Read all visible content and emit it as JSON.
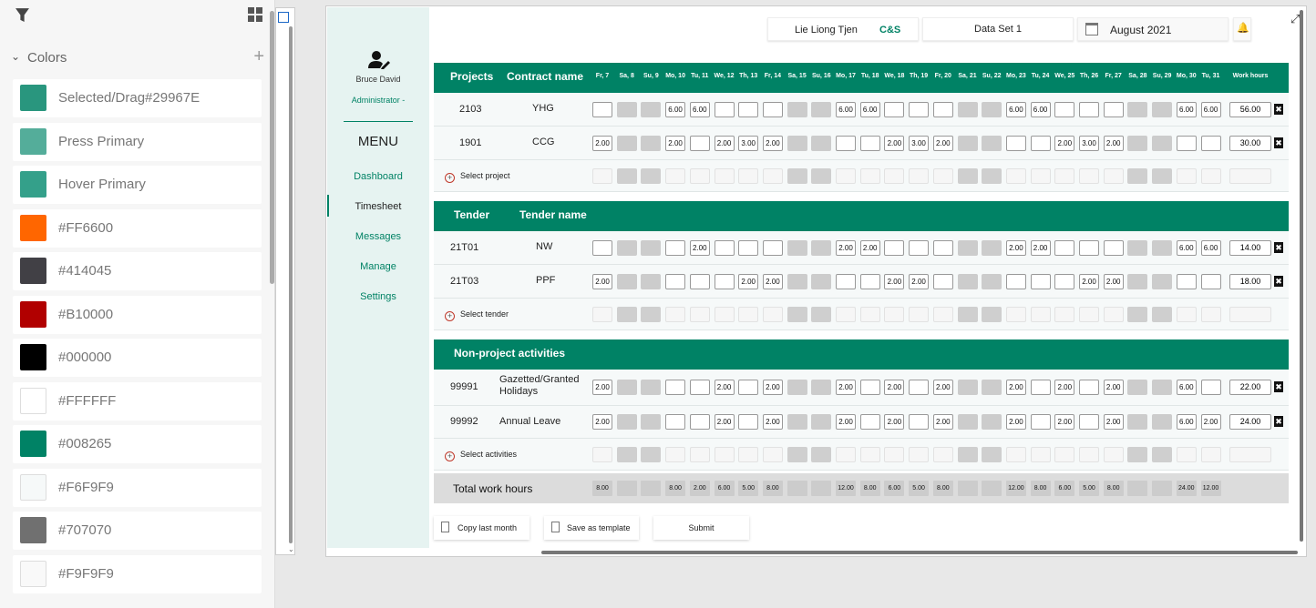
{
  "panel": {
    "section_title": "Colors",
    "swatches": [
      {
        "label": "Selected/Drag#29967E",
        "color": "#29967E"
      },
      {
        "label": "Press Primary",
        "color": "#54ad9a"
      },
      {
        "label": "Hover Primary",
        "color": "#34a08a"
      },
      {
        "label": "#FF6600",
        "color": "#FF6600"
      },
      {
        "label": "#414045",
        "color": "#414045"
      },
      {
        "label": "#B10000",
        "color": "#B10000"
      },
      {
        "label": "#000000",
        "color": "#000000"
      },
      {
        "label": "#FFFFFF",
        "color": "#FFFFFF"
      },
      {
        "label": "#008265",
        "color": "#008265"
      },
      {
        "label": "#F6F9F9",
        "color": "#F6F9F9"
      },
      {
        "label": "#707070",
        "color": "#707070"
      },
      {
        "label": "#F9F9F9",
        "color": "#F9F9F9"
      }
    ]
  },
  "app": {
    "user_name": "Bruce David",
    "user_role": "Administrator -",
    "menu_title": "MENU",
    "menu": [
      "Dashboard",
      "Timesheet",
      "Messages",
      "Manage",
      "Settings"
    ],
    "active_menu": "Timesheet",
    "topbar": {
      "user": "Lie Liong Tjen",
      "company": "C&S",
      "dataset": "Data Set 1",
      "month": "August 2021"
    },
    "days": [
      "Fr, 7",
      "Sa, 8",
      "Su, 9",
      "Mo, 10",
      "Tu, 11",
      "We, 12",
      "Th, 13",
      "Fr, 14",
      "Sa, 15",
      "Su, 16",
      "Mo, 17",
      "Tu, 18",
      "We, 18",
      "Th, 19",
      "Fr, 20",
      "Sa, 21",
      "Su, 22",
      "Mo, 23",
      "Tu, 24",
      "We, 25",
      "Th, 26",
      "Fr, 27",
      "Sa, 28",
      "Su, 29",
      "Mo, 30",
      "Tu, 31"
    ],
    "weekend_idx": [
      1,
      2,
      8,
      9,
      15,
      16,
      22,
      23
    ],
    "work_hours_label": "Work hours",
    "projects": {
      "col1": "Projects",
      "col2": "Contract name",
      "add_label": "Select project",
      "rows": [
        {
          "code": "2103",
          "name": "YHG",
          "total": "56.00",
          "hours": [
            "",
            "",
            "",
            "6.00",
            "6.00",
            "",
            "",
            "",
            "",
            "",
            "6.00",
            "6.00",
            "",
            "",
            "",
            "",
            "",
            "6.00",
            "6.00",
            "",
            "",
            "",
            "",
            "",
            "6.00",
            "6.00"
          ]
        },
        {
          "code": "1901",
          "name": "CCG",
          "total": "30.00",
          "hours": [
            "2.00",
            "",
            "",
            "2.00",
            "",
            "2.00",
            "3.00",
            "2.00",
            "",
            "",
            "",
            "",
            "2.00",
            "3.00",
            "2.00",
            "",
            "",
            "",
            "",
            "2.00",
            "3.00",
            "2.00",
            "",
            "",
            "",
            ""
          ]
        }
      ]
    },
    "tenders": {
      "col1": "Tender",
      "col2": "Tender name",
      "add_label": "Select tender",
      "rows": [
        {
          "code": "21T01",
          "name": "NW",
          "total": "14.00",
          "hours": [
            "",
            "",
            "",
            "",
            "2.00",
            "",
            "",
            "",
            "",
            "",
            "2.00",
            "2.00",
            "",
            "",
            "",
            "",
            "",
            "2.00",
            "2.00",
            "",
            "",
            "",
            "",
            "",
            "6.00",
            "6.00"
          ]
        },
        {
          "code": "21T03",
          "name": "PPF",
          "total": "18.00",
          "hours": [
            "2.00",
            "",
            "",
            "",
            "",
            "",
            "2.00",
            "2.00",
            "",
            "",
            "",
            "",
            "2.00",
            "2.00",
            "",
            "",
            "",
            "",
            "",
            "",
            "2.00",
            "2.00",
            "",
            "",
            "",
            ""
          ]
        }
      ]
    },
    "activities": {
      "col1": "Non-project activities",
      "add_label": "Select activities",
      "rows": [
        {
          "code": "99991",
          "name": "Gazetted/Granted Holidays",
          "total": "22.00",
          "hours": [
            "2.00",
            "",
            "",
            "",
            "",
            "2.00",
            "",
            "2.00",
            "",
            "",
            "2.00",
            "",
            "2.00",
            "",
            "2.00",
            "",
            "",
            "2.00",
            "",
            "2.00",
            "",
            "2.00",
            "",
            "",
            "6.00",
            ""
          ]
        },
        {
          "code": "99992",
          "name": "Annual Leave",
          "total": "24.00",
          "hours": [
            "2.00",
            "",
            "",
            "",
            "",
            "2.00",
            "",
            "2.00",
            "",
            "",
            "2.00",
            "",
            "2.00",
            "",
            "2.00",
            "",
            "",
            "2.00",
            "",
            "2.00",
            "",
            "2.00",
            "",
            "",
            "6.00",
            "2.00"
          ]
        }
      ]
    },
    "totals": {
      "label": "Total work hours",
      "hours": [
        "8.00",
        "",
        "",
        "8.00",
        "2.00",
        "6.00",
        "5.00",
        "8.00",
        "",
        "",
        "12.00",
        "8.00",
        "6.00",
        "5.00",
        "8.00",
        "",
        "",
        "12.00",
        "8.00",
        "6.00",
        "5.00",
        "8.00",
        "",
        "",
        "24.00",
        "12.00"
      ]
    },
    "buttons": {
      "copy": "Copy last month",
      "template": "Save as template",
      "submit": "Submit"
    }
  }
}
